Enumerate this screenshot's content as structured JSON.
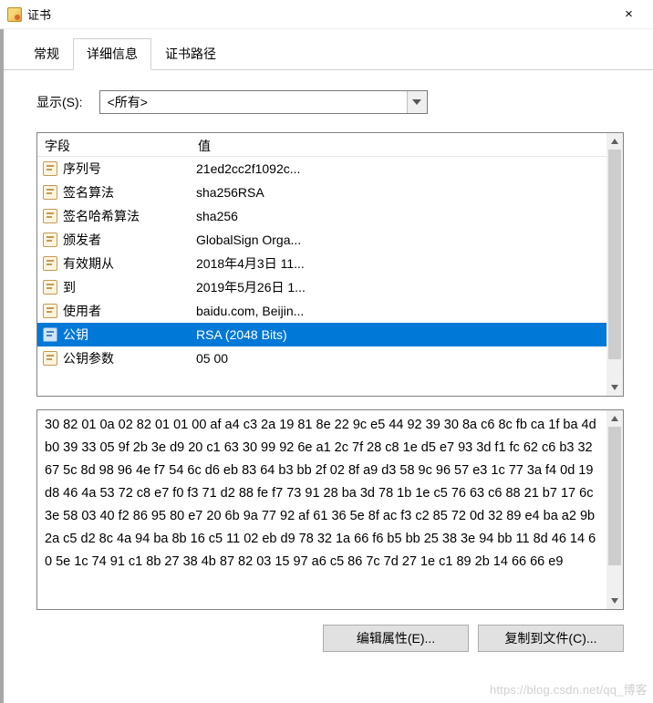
{
  "window": {
    "title": "证书",
    "close_label": "×"
  },
  "tabs": {
    "general": "常规",
    "details": "详细信息",
    "path": "证书路径"
  },
  "show": {
    "label": "显示(S):",
    "selected": "<所有>"
  },
  "list": {
    "columns": {
      "field": "字段",
      "value": "值"
    },
    "rows": [
      {
        "field": "序列号",
        "value": "21ed2cc2f1092c..."
      },
      {
        "field": "签名算法",
        "value": "sha256RSA"
      },
      {
        "field": "签名哈希算法",
        "value": "sha256"
      },
      {
        "field": "颁发者",
        "value": "GlobalSign Orga..."
      },
      {
        "field": "有效期从",
        "value": "2018年4月3日 11..."
      },
      {
        "field": "到",
        "value": "2019年5月26日 1..."
      },
      {
        "field": "使用者",
        "value": "baidu.com, Beijin..."
      },
      {
        "field": "公钥",
        "value": "RSA (2048 Bits)",
        "selected": true
      },
      {
        "field": "公钥参数",
        "value": "05 00"
      }
    ]
  },
  "hex": {
    "text": "30 82 01 0a 02 82 01 01 00 af a4 c3 2a 19 81 8e 22 9c e5 44 92 39 30 8a c6 8c fb ca 1f ba 4d b0 39 33 05 9f 2b 3e d9 20 c1 63 30 99 92 6e a1 2c 7f 28 c8 1e d5 e7 93 3d f1 fc 62 c6 b3 32 67 5c 8d 98 96 4e f7 54 6c d6 eb 83 64 b3 bb 2f 02 8f a9 d3 58 9c 96 57 e3 1c 77 3a f4 0d 19 d8 46 4a 53 72 c8 e7 f0 f3 71 d2 88 fe f7 73 91 28 ba 3d 78 1b 1e c5 76 63 c6 88 21 b7 17 6c 3e 58 03 40 f2 86 95 80 e7 20 6b 9a 77 92 af 61 36 5e 8f ac f3 c2 85 72 0d 32 89 e4 ba a2 9b 2a c5 d2 8c 4a 94 ba 8b 16 c5 11 02 eb d9 78 32 1a 66 f6 b5 bb 25 38 3e 94 bb 11 8d 46 14 60 5e 1c 74 91 c1 8b 27 38 4b 87 82 03 15 97 a6 c5 86 7c 7d 27 1e c1 89 2b 14 66 66 e9"
  },
  "buttons": {
    "edit_properties": "编辑属性(E)...",
    "copy_to_file": "复制到文件(C)..."
  },
  "watermark": "https://blog.csdn.net/qq_博客"
}
